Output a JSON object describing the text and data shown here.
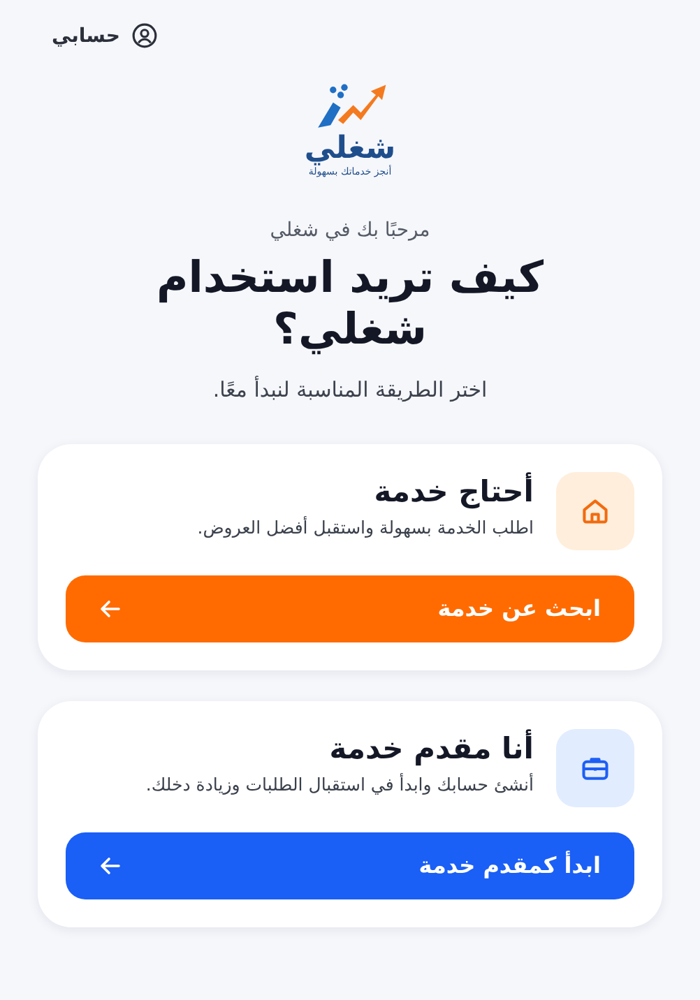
{
  "header": {
    "account_link": "حسابي"
  },
  "logo": {
    "name": "شغلي",
    "tagline": "أنجز خدماتك بسهولة"
  },
  "intro": {
    "welcome": "مرحبًا بك في شغلي",
    "title": "كيف تريد استخدام شغلي؟",
    "subtitle": "اختر الطريقة المناسبة لنبدأ معًا."
  },
  "options": [
    {
      "kind": "seeker",
      "title": "أحتاج خدمة",
      "description": "اطلب الخدمة بسهولة واستقبل أفضل العروض.",
      "button": "ابحث عن خدمة"
    },
    {
      "kind": "provider",
      "title": "أنا مقدم خدمة",
      "description": "أنشئ حسابك وابدأ في استقبال الطلبات وزيادة دخلك.",
      "button": "ابدأ كمقدم خدمة"
    }
  ]
}
